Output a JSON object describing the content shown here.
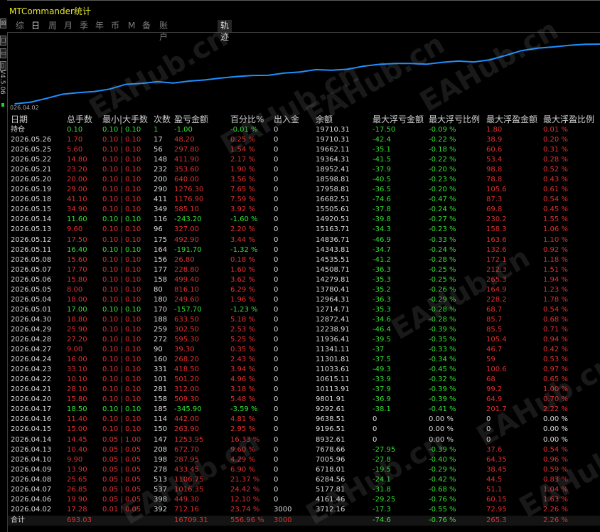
{
  "window": {
    "title": "MTCommander统计"
  },
  "tabs": [
    {
      "label": "综"
    },
    {
      "label": "日"
    },
    {
      "label": "周"
    },
    {
      "label": "月"
    },
    {
      "label": "季"
    },
    {
      "label": "年"
    },
    {
      "label": "币"
    },
    {
      "label": "M"
    },
    {
      "label": "备"
    },
    {
      "label": "账户"
    },
    {
      "label": "轨迹"
    }
  ],
  "selected_tab": "轨迹",
  "chart": {
    "start_label": "026.04.02",
    "side_caption": "V4.5.06",
    "line_color": "#1e90ff"
  },
  "chart_data": {
    "type": "line",
    "x": [
      "2026.04.02",
      "2026.04.06",
      "2026.04.07",
      "2026.04.08",
      "2026.04.09",
      "2026.04.10",
      "2026.04.13",
      "2026.04.14",
      "2026.04.15",
      "2026.04.16",
      "2026.04.17",
      "2026.04.20",
      "2026.04.21",
      "2026.04.22",
      "2026.04.23",
      "2026.04.24",
      "2026.04.27",
      "2026.04.28",
      "2026.04.29",
      "2026.04.30",
      "2026.05.01",
      "2026.05.04",
      "2026.05.05",
      "2026.05.06",
      "2026.05.07",
      "2026.05.08",
      "2026.05.11",
      "2026.05.12",
      "2026.05.13",
      "2026.05.14",
      "2026.05.15",
      "2026.05.18",
      "2026.05.19",
      "2026.05.20",
      "2026.05.21",
      "2026.05.22",
      "2026.05.25",
      "2026.05.26"
    ],
    "y": [
      3712.16,
      4161.46,
      5177.81,
      6284.56,
      6718.01,
      7005.96,
      7678.66,
      8932.61,
      9196.51,
      9638.51,
      9292.61,
      9801.91,
      10113.91,
      10615.11,
      11033.61,
      11301.81,
      11341.11,
      11936.41,
      12238.91,
      12872.41,
      12714.71,
      12964.31,
      13780.41,
      14279.81,
      14508.71,
      14535.51,
      14343.81,
      14836.71,
      15163.71,
      14920.51,
      15505.61,
      16682.51,
      17958.81,
      18598.81,
      18952.41,
      19364.31,
      19662.11,
      19710.31
    ]
  },
  "table": {
    "headers": [
      "日期",
      "总手数",
      "最小|大手数",
      "次数",
      "盈亏金额",
      "百分比%",
      "出入金",
      "余额",
      "最大浮亏金额",
      "最大浮亏比例",
      "最大浮盈金额",
      "最大浮盈比例"
    ],
    "position_row": [
      "持仓",
      "0.10",
      "0.10 | 0.10",
      "1",
      "-1.00",
      "-0.01 %",
      "0",
      "19710.31",
      "-17.50",
      "-0.09 %",
      "1.80",
      "0.01 %"
    ],
    "rows": [
      [
        "2026.05.26",
        "1.70",
        "0.10 | 0.10",
        "17",
        "48.20",
        "0.25 %",
        "0",
        "19710.31",
        "-42.4",
        "-0.22 %",
        "38.9",
        "0.20 %"
      ],
      [
        "2026.05.25",
        "5.60",
        "0.10 | 0.10",
        "56",
        "297.80",
        "1.54 %",
        "0",
        "19662.11",
        "-35.1",
        "-0.18 %",
        "60.6",
        "0.31 %"
      ],
      [
        "2026.05.22",
        "14.80",
        "0.10 | 0.10",
        "148",
        "411.90",
        "2.17 %",
        "0",
        "19364.31",
        "-41.5",
        "-0.22 %",
        "53.4",
        "0.28 %"
      ],
      [
        "2026.05.21",
        "23.20",
        "0.10 | 0.10",
        "232",
        "353.60",
        "1.90 %",
        "0",
        "18952.41",
        "-37.9",
        "-0.20 %",
        "98.8",
        "0.52 %"
      ],
      [
        "2026.05.20",
        "20.00",
        "0.10 | 0.10",
        "200",
        "640.00",
        "3.56 %",
        "0",
        "18598.81",
        "-40.5",
        "-0.23 %",
        "78.8",
        "0.43 %"
      ],
      [
        "2026.05.19",
        "29.00",
        "0.10 | 0.10",
        "290",
        "1276.30",
        "7.65 %",
        "0",
        "17958.81",
        "-36.5",
        "-0.20 %",
        "105.6",
        "0.61 %"
      ],
      [
        "2026.05.18",
        "41.10",
        "0.10 | 0.10",
        "411",
        "1176.90",
        "7.59 %",
        "0",
        "16682.51",
        "-74.6",
        "-0.47 %",
        "87.3",
        "0.54 %"
      ],
      [
        "2026.05.15",
        "34.90",
        "0.10 | 0.10",
        "349",
        "585.10",
        "3.92 %",
        "0",
        "15505.61",
        "-37.8",
        "-0.24 %",
        "69.8",
        "0.45 %"
      ],
      [
        "2026.05.14",
        "11.60",
        "0.10 | 0.10",
        "116",
        "-243.20",
        "-1.60 %",
        "0",
        "14920.51",
        "-39.8",
        "-0.27 %",
        "230.2",
        "1.55 %"
      ],
      [
        "2026.05.13",
        "9.60",
        "0.10 | 0.10",
        "96",
        "327.00",
        "2.20 %",
        "0",
        "15163.71",
        "-34.3",
        "-0.23 %",
        "158.3",
        "1.06 %"
      ],
      [
        "2026.05.12",
        "17.50",
        "0.10 | 0.10",
        "175",
        "492.90",
        "3.44 %",
        "0",
        "14836.71",
        "-46.9",
        "-0.33 %",
        "163.6",
        "1.10 %"
      ],
      [
        "2026.05.11",
        "16.40",
        "0.10 | 0.10",
        "164",
        "-191.70",
        "-1.32 %",
        "0",
        "14343.81",
        "-34.7",
        "-0.24 %",
        "132.6",
        "0.92 %"
      ],
      [
        "2026.05.08",
        "15.60",
        "0.10 | 0.10",
        "156",
        "26.80",
        "0.18 %",
        "0",
        "14535.51",
        "-41.2",
        "-0.28 %",
        "172.1",
        "1.18 %"
      ],
      [
        "2026.05.07",
        "17.70",
        "0.10 | 0.10",
        "177",
        "228.80",
        "1.60 %",
        "0",
        "14508.71",
        "-36.3",
        "-0.25 %",
        "212.3",
        "1.51 %"
      ],
      [
        "2026.05.06",
        "15.80",
        "0.10 | 0.10",
        "158",
        "499.40",
        "3.62 %",
        "0",
        "14279.81",
        "-35.3",
        "-0.25 %",
        "265.3",
        "1.94 %"
      ],
      [
        "2026.05.05",
        "8.00",
        "0.10 | 0.10",
        "80",
        "816.10",
        "6.29 %",
        "0",
        "13780.41",
        "-35.2",
        "-0.26 %",
        "164.9",
        "1.23 %"
      ],
      [
        "2026.05.04",
        "18.00",
        "0.10 | 0.10",
        "180",
        "249.60",
        "1.96 %",
        "0",
        "12964.31",
        "-36.3",
        "-0.29 %",
        "228.2",
        "1.78 %"
      ],
      [
        "2026.05.01",
        "17.00",
        "0.10 | 0.10",
        "170",
        "-157.70",
        "-1.23 %",
        "0",
        "12714.71",
        "-35.3",
        "-0.28 %",
        "68.7",
        "0.54 %"
      ],
      [
        "2026.04.30",
        "18.80",
        "0.10 | 0.10",
        "188",
        "633.50",
        "5.18 %",
        "0",
        "12872.41",
        "-34.6",
        "-0.28 %",
        "85.7",
        "0.68 %"
      ],
      [
        "2026.04.29",
        "25.90",
        "0.10 | 0.10",
        "259",
        "302.50",
        "2.53 %",
        "0",
        "12238.91",
        "-46.4",
        "-0.39 %",
        "85.5",
        "0.71 %"
      ],
      [
        "2026.04.28",
        "27.20",
        "0.10 | 0.10",
        "272",
        "595.30",
        "5.25 %",
        "0",
        "11936.41",
        "-39.5",
        "-0.35 %",
        "105.4",
        "0.94 %"
      ],
      [
        "2026.04.27",
        "9.00",
        "0.10 | 0.10",
        "90",
        "39.30",
        "0.35 %",
        "0",
        "11341.11",
        "-37",
        "-0.33 %",
        "46.7",
        "0.42 %"
      ],
      [
        "2026.04.24",
        "16.00",
        "0.10 | 0.10",
        "160",
        "268.20",
        "2.43 %",
        "0",
        "11301.81",
        "-37.5",
        "-0.34 %",
        "59",
        "0.53 %"
      ],
      [
        "2026.04.23",
        "33.10",
        "0.10 | 0.10",
        "331",
        "418.50",
        "3.94 %",
        "0",
        "11033.61",
        "-49.3",
        "-0.45 %",
        "100.6",
        "0.97 %"
      ],
      [
        "2026.04.22",
        "10.10",
        "0.10 | 0.10",
        "101",
        "501.20",
        "4.96 %",
        "0",
        "10615.11",
        "-33.9",
        "-0.32 %",
        "68",
        "0.65 %"
      ],
      [
        "2026.04.21",
        "28.10",
        "0.10 | 0.10",
        "281",
        "312.00",
        "3.18 %",
        "0",
        "10113.91",
        "-37.9",
        "-0.39 %",
        "99.2",
        "1.00 %"
      ],
      [
        "2026.04.20",
        "15.80",
        "0.10 | 0.10",
        "158",
        "509.30",
        "5.48 %",
        "0",
        "9801.91",
        "-36.9",
        "-0.39 %",
        "64.9",
        "0.70 %"
      ],
      [
        "2026.04.17",
        "18.50",
        "0.10 | 0.10",
        "185",
        "-345.90",
        "-3.59 %",
        "0",
        "9292.61",
        "-38.1",
        "-0.41 %",
        "201.7",
        "2.22 %"
      ],
      [
        "2026.04.16",
        "11.40",
        "0.10 | 0.10",
        "114",
        "442.00",
        "4.81 %",
        "0",
        "9638.51",
        "0",
        "0.00 %",
        "0",
        "0.00 %"
      ],
      [
        "2026.04.15",
        "15.00",
        "0.10 | 0.10",
        "150",
        "263.90",
        "2.95 %",
        "0",
        "9196.51",
        "0",
        "0.00 %",
        "0",
        "0.00 %"
      ],
      [
        "2026.04.14",
        "14.45",
        "0.05 | 1.00",
        "147",
        "1253.95",
        "16.33 %",
        "0",
        "8932.61",
        "0",
        "0.00 %",
        "0",
        "0.00 %"
      ],
      [
        "2026.04.13",
        "10.40",
        "0.05 | 0.05",
        "208",
        "672.70",
        "9.60 %",
        "0",
        "7678.66",
        "-27.95",
        "-0.39 %",
        "37.6",
        "0.54 %"
      ],
      [
        "2026.04.10",
        "9.90",
        "0.05 | 0.05",
        "198",
        "287.95",
        "4.29 %",
        "0",
        "7005.96",
        "-27.8",
        "-0.40 %",
        "64.35",
        "0.96 %"
      ],
      [
        "2026.04.09",
        "13.90",
        "0.05 | 0.05",
        "278",
        "433.45",
        "6.90 %",
        "0",
        "6718.01",
        "-19.5",
        "-0.29 %",
        "38.45",
        "0.59 %"
      ],
      [
        "2026.04.08",
        "25.65",
        "0.05 | 0.05",
        "513",
        "1106.75",
        "21.37 %",
        "0",
        "6284.56",
        "-24.1",
        "-0.42 %",
        "44.5",
        "0.83 %"
      ],
      [
        "2026.04.07",
        "26.85",
        "0.05 | 0.05",
        "537",
        "1016.35",
        "24.42 %",
        "0",
        "5177.81",
        "-31.8",
        "-0.68 %",
        "51.1",
        "1.04 %"
      ],
      [
        "2026.04.06",
        "19.90",
        "0.05 | 0.05",
        "398",
        "449.30",
        "12.10 %",
        "0",
        "4161.46",
        "-29.25",
        "-0.76 %",
        "60.15",
        "1.63 %"
      ],
      [
        "2026.04.02",
        "17.28",
        "0.01 | 0.05",
        "392",
        "712.16",
        "23.74 %",
        "3000",
        "3712.16",
        "-17.3",
        "-0.55 %",
        "72.95",
        "2.26 %"
      ]
    ],
    "total_row": [
      "合计",
      "693.03",
      "",
      "",
      "16709.31",
      "556.96 %",
      "3000",
      "",
      "-74.6",
      "-0.76 %",
      "265.3",
      "2.26 %"
    ]
  },
  "watermark_text": "EAHub.cn"
}
